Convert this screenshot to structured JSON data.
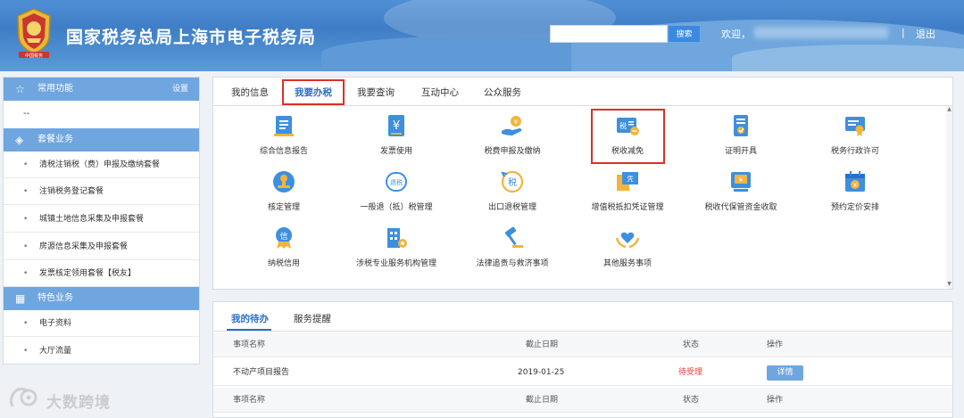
{
  "header": {
    "emblem_caption": "中国税务",
    "site_title": "国家税务总局上海市电子税务局",
    "search": {
      "button_label": "搜索",
      "placeholder": ""
    },
    "welcome_label": "欢迎，",
    "separator": "|",
    "logout_label": "退出"
  },
  "sidebar": {
    "favorites": {
      "title": "常用功能",
      "action": "设置",
      "icon": "star-icon"
    },
    "favorites_empty": "--",
    "packages": {
      "title": "套餐业务",
      "icon": "layers-icon",
      "items": [
        {
          "label": "清税注销税（费）申报及缴纳套餐"
        },
        {
          "label": "注销税务登记套餐"
        },
        {
          "label": "城镇土地信息采集及申报套餐"
        },
        {
          "label": "房源信息采集及申报套餐"
        },
        {
          "label": "发票核定领用套餐【税友】"
        }
      ]
    },
    "featured": {
      "title": "特色业务",
      "icon": "grid-icon",
      "items": [
        {
          "label": "电子资料"
        },
        {
          "label": "大厅流量"
        }
      ]
    }
  },
  "main": {
    "tabs": [
      {
        "label": "我的信息"
      },
      {
        "label": "我要办税",
        "active": true
      },
      {
        "label": "我要查询"
      },
      {
        "label": "互动中心"
      },
      {
        "label": "公众服务"
      }
    ],
    "services": [
      {
        "label": "综合信息报告",
        "icon": "report-icon"
      },
      {
        "label": "发票使用",
        "icon": "invoice-yen-icon"
      },
      {
        "label": "税费申报及缴纳",
        "icon": "coin-hand-icon"
      },
      {
        "label": "税收减免",
        "icon": "tax-reduction-icon",
        "highlighted": true
      },
      {
        "label": "证明开具",
        "icon": "certificate-icon"
      },
      {
        "label": "税务行政许可",
        "icon": "license-badge-icon"
      },
      {
        "label": "核定管理",
        "icon": "stamp-icon"
      },
      {
        "label": "一般退（抵）税管理",
        "icon": "refund-icon"
      },
      {
        "label": "出口退税管理",
        "icon": "export-refund-icon"
      },
      {
        "label": "增值税抵扣凭证管理",
        "icon": "voucher-icon"
      },
      {
        "label": "税收代保管资金收取",
        "icon": "fund-custody-icon"
      },
      {
        "label": "预约定价安排",
        "icon": "calendar-yen-icon"
      },
      {
        "label": "纳税信用",
        "icon": "credit-medal-icon"
      },
      {
        "label": "涉税专业服务机构管理",
        "icon": "building-gear-icon"
      },
      {
        "label": "法律追责与救济事项",
        "icon": "gavel-icon"
      },
      {
        "label": "其他服务事项",
        "icon": "heart-hands-icon"
      }
    ],
    "todo": {
      "tabs": [
        {
          "label": "我的待办",
          "active": true
        },
        {
          "label": "服务提醒"
        }
      ],
      "columns": [
        "事项名称",
        "截止日期",
        "状态",
        "操作"
      ],
      "rows": [
        {
          "name": "不动产项目报告",
          "deadline": "2019-01-25",
          "status": "待受理",
          "action": "详情"
        }
      ]
    }
  },
  "watermark": {
    "text": "大数跨境"
  },
  "colors": {
    "header_blue": "#3f7ec6",
    "section_blue": "#6fa6df",
    "active_tab": "#2a6fc9",
    "highlight_red": "#d9302a",
    "status_red": "#e0413a"
  }
}
